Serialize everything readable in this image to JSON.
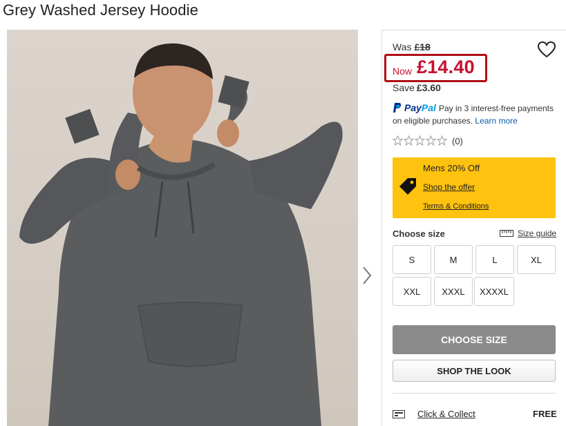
{
  "product": {
    "title": "Grey Washed Jersey Hoodie"
  },
  "gallery": {
    "next_icon": "chevron-right-icon"
  },
  "price": {
    "was_label": "Was",
    "was_value": "£18",
    "now_label": "Now",
    "now_value": "£14.40",
    "save_label": "Save",
    "save_value": "£3.60",
    "sale_color": "#c8102e",
    "highlight_color": "#b10c14"
  },
  "wishlist": {
    "icon": "heart-icon"
  },
  "paypal": {
    "brand_pay": "Pay",
    "brand_pal": "Pal",
    "text": "Pay in 3 interest-free payments on eligible purchases.",
    "learn_more": "Learn more"
  },
  "rating": {
    "stars": 0,
    "max": 5,
    "count": "(0)"
  },
  "offer": {
    "title": "Mens 20% Off",
    "link": "Shop the offer",
    "terms": "Terms & Conditions",
    "background": "#ffc20e",
    "icon": "price-tag-icon"
  },
  "size": {
    "label": "Choose size",
    "guide_label": "Size guide",
    "options": [
      "S",
      "M",
      "L",
      "XL",
      "XXL",
      "XXXL",
      "XXXXL"
    ]
  },
  "actions": {
    "choose_size": "CHOOSE SIZE",
    "shop_the_look": "SHOP THE LOOK"
  },
  "delivery": {
    "label": "Click & Collect",
    "price": "FREE",
    "icon": "store-icon"
  }
}
